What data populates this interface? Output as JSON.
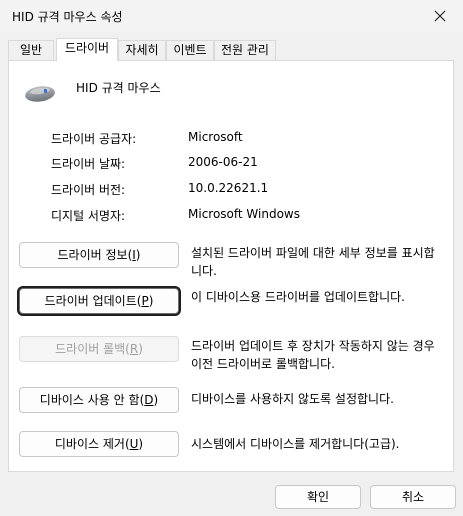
{
  "window": {
    "title": "HID 규격 마우스 속성",
    "close_icon": "close-icon"
  },
  "tabs": [
    {
      "label": "일반",
      "active": false
    },
    {
      "label": "드라이버",
      "active": true
    },
    {
      "label": "자세히",
      "active": false
    },
    {
      "label": "이벤트",
      "active": false
    },
    {
      "label": "전원 관리",
      "active": false
    }
  ],
  "device": {
    "name": "HID 규격 마우스",
    "icon": "mouse-icon"
  },
  "info": [
    {
      "label": "드라이버 공급자:",
      "value": "Microsoft"
    },
    {
      "label": "드라이버 날짜:",
      "value": "2006-06-21"
    },
    {
      "label": "드라이버 버전:",
      "value": "10.0.22621.1"
    },
    {
      "label": "디지털 서명자:",
      "value": "Microsoft Windows"
    }
  ],
  "actions": [
    {
      "label": "드라이버 정보",
      "mnemonic": "I",
      "enabled": true,
      "focused": false,
      "desc": "설치된 드라이버 파일에 대한 세부 정보를 표시합니다."
    },
    {
      "label": "드라이버 업데이트",
      "mnemonic": "P",
      "enabled": true,
      "focused": true,
      "desc": "이 디바이스용 드라이버를 업데이트합니다."
    },
    {
      "label": "드라이버 롤백",
      "mnemonic": "R",
      "enabled": false,
      "focused": false,
      "desc": "드라이버 업데이트 후 장치가 작동하지 않는 경우 이전 드라이버로 롤백합니다."
    },
    {
      "label": "디바이스 사용 안 함",
      "mnemonic": "D",
      "enabled": true,
      "focused": false,
      "desc": "디바이스를 사용하지 않도록 설정합니다."
    },
    {
      "label": "디바이스 제거",
      "mnemonic": "U",
      "enabled": true,
      "focused": false,
      "desc": "시스템에서 디바이스를 제거합니다(고급)."
    }
  ],
  "footer": {
    "ok_label": "확인",
    "cancel_label": "취소"
  }
}
